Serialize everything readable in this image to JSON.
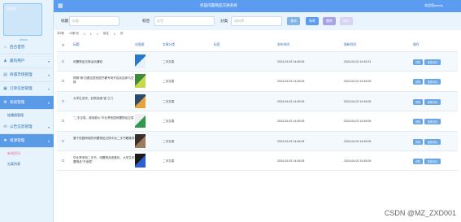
{
  "sidebar": {
    "avatar_text": "在此处",
    "user_name": "admin",
    "menu": [
      {
        "label": "后台首页",
        "icon": "home-icon",
        "has_caret": false,
        "active": false
      },
      {
        "label": "最热用户",
        "icon": "user-icon",
        "has_caret": true,
        "active": false
      },
      {
        "label": "商城市场管理",
        "icon": "shop-icon",
        "has_caret": true,
        "active": false
      },
      {
        "label": "订单信息管理",
        "icon": "order-icon",
        "has_caret": true,
        "active": false
      },
      {
        "label": "系统管理",
        "icon": "gear-icon",
        "has_caret": true,
        "active": true,
        "sub": [
          {
            "label": "轮播图管理",
            "active": false
          }
        ]
      },
      {
        "label": "公告信息管理",
        "icon": "notice-icon",
        "has_caret": true,
        "active": false
      },
      {
        "label": "资源管理",
        "icon": "resource-icon",
        "has_caret": true,
        "active": true,
        "sub": [
          {
            "label": "新闻资讯",
            "active": true
          },
          {
            "label": "分类列表",
            "active": false
          }
        ]
      }
    ]
  },
  "topbar": {
    "title": "校园闲置物品交换系统",
    "user": "欢迎您admin"
  },
  "search": {
    "fields": [
      {
        "label": "标题",
        "placeholder": "标题"
      },
      {
        "label": "标签",
        "placeholder": "标签"
      },
      {
        "label": "分类",
        "placeholder": "请选择"
      }
    ],
    "buttons": {
      "search": "查询",
      "add": "新增",
      "delete": "删除",
      "stat": "统计"
    }
  },
  "pager": {
    "info": "共6条",
    "page_size": "10条/页",
    "prev": "<",
    "page": "1",
    "next": ">",
    "goto": "前往",
    "goto_page": "1",
    "page_unit": "页"
  },
  "table": {
    "headers": [
      "标题",
      "封面图",
      "文章分类",
      "标签",
      "发布时间",
      "更新时间",
      "操作"
    ],
    "rows": [
      {
        "title": "闲置物品交换活动通知",
        "category": "二手交易",
        "tag": "",
        "published": "2024-04-03 14:45:05",
        "updated": "2024-04-03 14:45:31",
        "img_colors": [
          "#2a79c9",
          "#e7f1fb"
        ]
      },
      {
        "title": "物物\"换\"旧看这里校园书籍专场开启欢迎参与交换",
        "category": "二手交易",
        "tag": "",
        "published": "2024-04-03 14:45:05",
        "updated": "2024-04-03 14:45:05",
        "img_colors": [
          "#3f8a3a",
          "#c9d94d"
        ]
      },
      {
        "title": "大学生旧衣、旧物变废\"宝\"之门",
        "category": "二手交易",
        "tag": "",
        "published": "2024-04-03 14:45:05",
        "updated": "2024-04-03 14:45:05",
        "img_colors": [
          "#2e4a6b",
          "#e8a23a"
        ]
      },
      {
        "title": "\"二手交易，越卖越火\"毕业季校园闲置物品交易",
        "category": "二手交易",
        "tag": "",
        "published": "2024-04-03 14:45:05",
        "updated": "2024-04-03 14:45:05",
        "img_colors": [
          "#f0f0f0",
          "#2f9a4e"
        ]
      },
      {
        "title": "基于校园网络的闲置物品交换平台二手书籍推荐",
        "category": "二手交易",
        "tag": "",
        "published": "2024-04-03 14:45:05",
        "updated": "2024-04-03 14:45:05",
        "img_colors": [
          "#3a2e2a",
          "#9a7b5a"
        ]
      },
      {
        "title": "毕业季来啦二手书、闲置物品收集处，大学生闲置物品\"不浪费\"",
        "category": "二手交易",
        "tag": "",
        "published": "2024-04-03 14:45:05",
        "updated": "2024-04-03 14:45:05",
        "img_colors": [
          "#1a1a1a",
          "#2a5fd0"
        ]
      }
    ],
    "op_detail": "详情",
    "op_view": "查看评论"
  },
  "watermark": "CSDN @MZ_ZXD001"
}
